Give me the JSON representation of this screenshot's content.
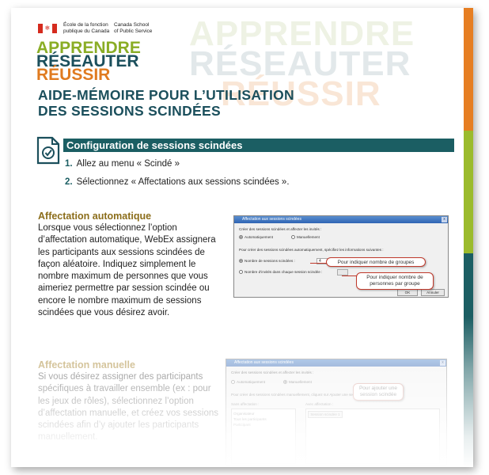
{
  "header": {
    "org_fr": "École de la fonction\npublique du Canada",
    "org_en": "Canada School\nof Public Service",
    "background_words": [
      "APPRENDRE",
      "RÉSEAUTER",
      "RÉUSSIR"
    ],
    "motto": [
      "APPRENDRE",
      "RÉSEAUTER",
      "RÉUSSIR"
    ]
  },
  "title": {
    "line1": "AIDE-MÉMOIRE POUR L’UTILISATION",
    "line2": "DES SESSIONS SCINDÉES"
  },
  "section": {
    "heading": "Configuration de sessions scindées",
    "icon": "document-check-icon",
    "steps": [
      {
        "num": "1.",
        "text": "Allez au menu « Scindé »"
      },
      {
        "num": "2.",
        "text": "Sélectionnez « Affectations aux sessions scindées »."
      }
    ]
  },
  "auto": {
    "heading": "Affectation automatique",
    "text": "Lorsque vous sélectionnez l’option d’affectation automatique, WebEx assignera les participants aux sessions scindées de façon aléatoire.  Indiquez simplement le nombre maximum de personnes que vous aimeriez permettre par session scindée ou encore le nombre maximum de sessions scindées que vous désirez avoir.",
    "dialog": {
      "title": "Affectation aux sessions scindées",
      "close": "x",
      "prompt": "Créer des sessions scindées et affecter les invités :",
      "radio_auto": "Automatiquement",
      "radio_manual": "Manuellement",
      "instruction": "Pour créer des sessions scindées automatiquement, spécifiez les informations suivantes :",
      "field1_label": "Nombre de sessions scindées :",
      "field1_value": "4",
      "field2_label": "Nombre d’invités dans chaque session scindée :",
      "field2_value": "",
      "ok": "OK",
      "cancel": "Annuler",
      "callout1": "Pour indiquer nombre de groupes",
      "callout2": "Pour indiquer nombre de personnes par groupe"
    }
  },
  "manual": {
    "heading": "Affectation manuelle",
    "text": "Si vous désirez assigner des participants spécifiques à travailler ensemble (ex : pour les jeux de rôles), sélectionnez l’option d’affectation manuelle,  et créez vos sessions scindées afin d’y ajouter les participants manuellement.",
    "dialog": {
      "title": "Affectation aux sessions scindées",
      "close": "x",
      "prompt": "Créer des sessions scindées et affecter les invités :",
      "radio_auto": "Automatiquement",
      "radio_manual": "Manuellement",
      "instruction": "Pour créer des sessions scindées manuellement, cliquez sur Ajouter une session scindée...",
      "left_label": "Sans affectation :",
      "right_label": "Avec affectation :",
      "add_button": "Session scindée 1",
      "list_items": [
        "Organisateur",
        "Tous les participants",
        "Participant"
      ],
      "callout": "Pour ajouter une session scindée"
    }
  }
}
